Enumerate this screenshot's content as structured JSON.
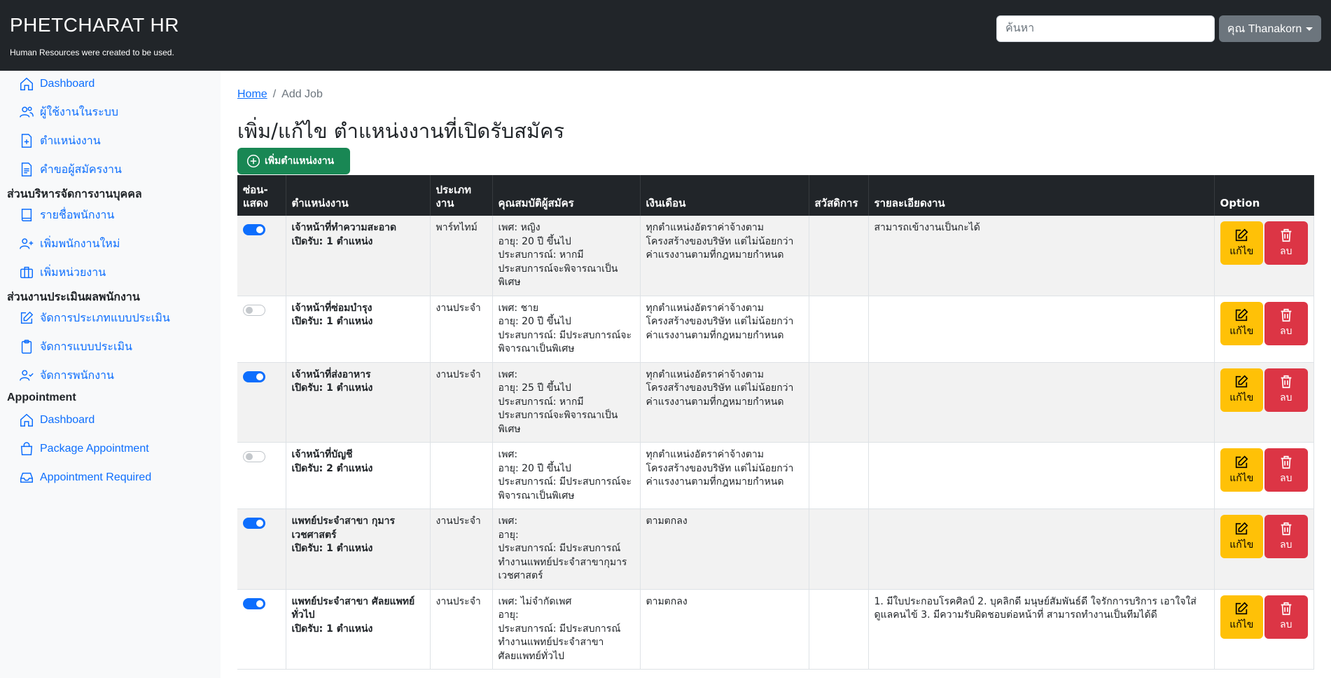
{
  "header": {
    "brand": "PHETCHARAT HR",
    "tagline": "Human Resources were created to be used.",
    "search_placeholder": "ค้นหา",
    "user_label": "คุณ Thanakorn"
  },
  "sidebar": {
    "items": [
      {
        "label": "Dashboard",
        "icon": "house-icon"
      },
      {
        "label": "ผู้ใช้งานในระบบ",
        "icon": "people-icon"
      },
      {
        "label": "ตำแหน่งงาน",
        "icon": "file-plus-icon"
      },
      {
        "label": "คำขอผู้สมัครงาน",
        "icon": "file-text-icon"
      }
    ],
    "section_personnel": "ส่วนบริหารจัดการงานบุคคล",
    "personnel_items": [
      {
        "label": "รายชื่อพนักงาน",
        "icon": "book-icon"
      },
      {
        "label": "เพิ่มพนักงานใหม่",
        "icon": "person-plus-icon"
      },
      {
        "label": "เพิ่มหน่วยงาน",
        "icon": "briefcase-icon"
      }
    ],
    "section_evaluation": "ส่วนงานประเมินผลพนักงาน",
    "evaluation_items": [
      {
        "label": "จัดการประเภทแบบประเมิน",
        "icon": "pencil-square-icon"
      },
      {
        "label": "จัดการแบบประเมิน",
        "icon": "clipboard-icon"
      },
      {
        "label": "จัดการพนักงาน",
        "icon": "person-check-icon"
      }
    ],
    "section_appointment": "Appointment",
    "appointment_items": [
      {
        "label": "Dashboard",
        "icon": "house-icon"
      },
      {
        "label": "Package Appointment",
        "icon": "bag-icon"
      },
      {
        "label": "Appointment Required",
        "icon": "inbox-icon"
      }
    ]
  },
  "breadcrumb": {
    "home": "Home",
    "separator": "/",
    "current": "Add Job"
  },
  "page_title": "เพิ่ม/แก้ไข ตำแหน่งงานที่เปิดรับสมัคร",
  "add_button": "เพิ่มตำแหน่งงาน",
  "table": {
    "headers": [
      "ซ่อน-แสดง",
      "ตำแหน่งงาน",
      "ประเภทงาน",
      "คุณสมบัติผู้สมัคร",
      "เงินเดือน",
      "สวัสดิการ",
      "รายละเอียดงาน",
      "Option"
    ],
    "edit_label": "แก้ไข",
    "delete_label": "ลบ",
    "rows": [
      {
        "visible": true,
        "title": "เจ้าหน้าที่ทำความสะอาด",
        "openings": "เปิดรับ: 1 ตำแหน่ง",
        "type": "พาร์ทไทม์",
        "gender": "เพศ: หญิง",
        "age": "อายุ: 20 ปี ขึ้นไป",
        "experience": "ประสบการณ์: หากมีประสบการณ์จะพิจารณาเป็นพิเศษ",
        "salary": "ทุกตำแหน่งอัตราค่าจ้างตามโครงสร้างของบริษัท แต่ไม่น้อยกว่าค่าแรงงานตามที่กฎหมายกำหนด",
        "welfare": "",
        "details": "สามารถเข้างานเป็นกะได้"
      },
      {
        "visible": false,
        "title": "เจ้าหน้าที่ซ่อมบำรุง",
        "openings": "เปิดรับ: 1 ตำแหน่ง",
        "type": "งานประจำ",
        "gender": "เพศ: ชาย",
        "age": "อายุ: 20 ปี ขึ้นไป",
        "experience": "ประสบการณ์: มีประสบการณ์จะพิจารณาเป็นพิเศษ",
        "salary": "ทุกตำแหน่งอัตราค่าจ้างตามโครงสร้างของบริษัท แต่ไม่น้อยกว่าค่าแรงงานตามที่กฎหมายกำหนด",
        "welfare": "",
        "details": ""
      },
      {
        "visible": true,
        "title": "เจ้าหน้าที่ส่งอาหาร",
        "openings": "เปิดรับ: 1 ตำแหน่ง",
        "type": "งานประจำ",
        "gender": "เพศ:",
        "age": "อายุ: 25 ปี ขึ้นไป",
        "experience": "ประสบการณ์: หากมีประสบการณ์จะพิจารณาเป็นพิเศษ",
        "salary": "ทุกตำแหน่งอัตราค่าจ้างตามโครงสร้างของบริษัท แต่ไม่น้อยกว่าค่าแรงงานตามที่กฎหมายกำหนด",
        "welfare": "",
        "details": ""
      },
      {
        "visible": false,
        "title": "เจ้าหน้าที่บัญชี",
        "openings": "เปิดรับ: 2 ตำแหน่ง",
        "type": "",
        "gender": "เพศ:",
        "age": "อายุ: 20 ปี ขึ้นไป",
        "experience": "ประสบการณ์: มีประสบการณ์จะพิจารณาเป็นพิเศษ",
        "salary": "ทุกตำแหน่งอัตราค่าจ้างตามโครงสร้างของบริษัท แต่ไม่น้อยกว่าค่าแรงงานตามที่กฎหมายกำหนด",
        "welfare": "",
        "details": ""
      },
      {
        "visible": true,
        "title": "แพทย์ประจำสาขา กุมารเวชศาสตร์",
        "openings": "เปิดรับ: 1 ตำแหน่ง",
        "type": "งานประจำ",
        "gender": "เพศ:",
        "age": "อายุ:",
        "experience": "ประสบการณ์: มีประสบการณ์ทำงานแพทย์ประจำสาขากุมารเวชศาสตร์",
        "salary": "ตามตกลง",
        "welfare": "",
        "details": ""
      },
      {
        "visible": true,
        "title": "แพทย์ประจำสาขา ศัลยแพทย์ทั่วไป",
        "openings": "เปิดรับ: 1 ตำแหน่ง",
        "type": "งานประจำ",
        "gender": "เพศ: ไม่จำกัดเพศ",
        "age": "อายุ:",
        "experience": "ประสบการณ์: มีประสบการณ์ทำงานแพทย์ประจำสาขาศัลยแพทย์ทั่วไป",
        "salary": "ตามตกลง",
        "welfare": "",
        "details": "1. มีใบประกอบโรคศิลป์ 2. บุคลิกดี มนุษย์สัมพันธ์ดี ใจรักการบริการ เอาใจใส่ดูแลคนไข้ 3. มีความรับผิดชอบต่อหน้าที่ สามารถทำงานเป็นทีมได้ดี"
      }
    ]
  },
  "colors": {
    "topbar": "#212529",
    "link": "#0d6efd",
    "success": "#198754",
    "warning": "#ffc107",
    "danger": "#dc3545"
  }
}
